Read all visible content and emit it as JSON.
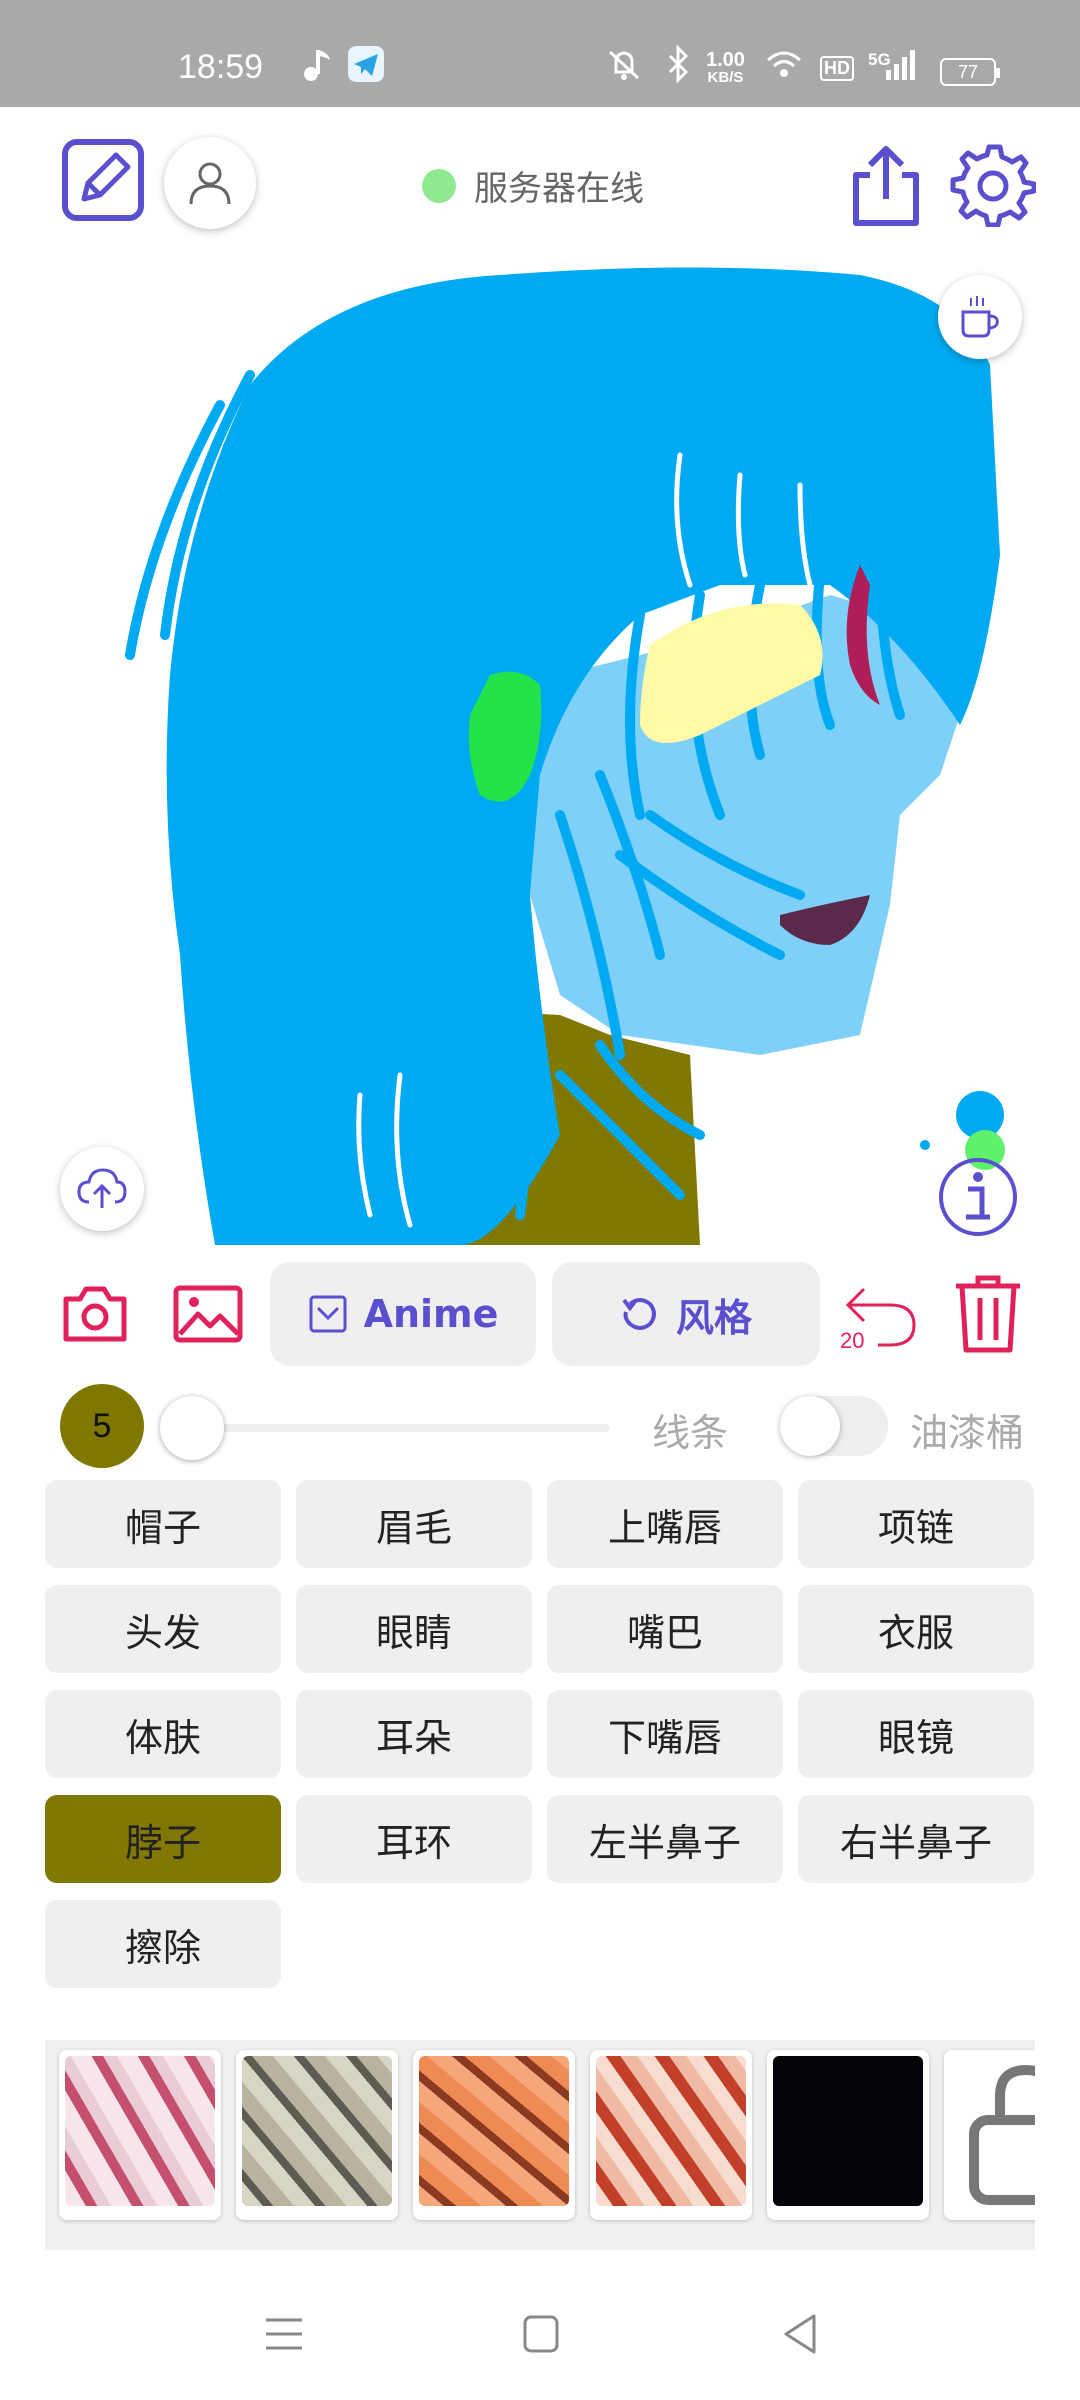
{
  "status_bar": {
    "time": "18:59",
    "net_speed_value": "1.00",
    "net_speed_unit": "KB/S",
    "network": "5G",
    "hd": "HD",
    "battery": "77"
  },
  "header": {
    "server_status": "服务器在线",
    "server_status_color": "#8fea8f"
  },
  "toolbar": {
    "anime_label": "Anime",
    "style_label": "风格",
    "undo_count": "20"
  },
  "brush": {
    "size": "5",
    "color": "#807800",
    "line_label": "线条",
    "bucket_label": "油漆桶",
    "bucket_enabled": false
  },
  "parts": [
    {
      "label": "帽子"
    },
    {
      "label": "眉毛"
    },
    {
      "label": "上嘴唇"
    },
    {
      "label": "项链"
    },
    {
      "label": "头发"
    },
    {
      "label": "眼睛"
    },
    {
      "label": "嘴巴"
    },
    {
      "label": "衣服"
    },
    {
      "label": "体肤"
    },
    {
      "label": "耳朵"
    },
    {
      "label": "下嘴唇"
    },
    {
      "label": "眼镜"
    },
    {
      "label": "脖子",
      "selected": true
    },
    {
      "label": "耳环"
    },
    {
      "label": "左半鼻子"
    },
    {
      "label": "右半鼻子"
    },
    {
      "label": "擦除"
    }
  ],
  "accent_color": "#5a4fcf",
  "danger_color": "#e0215a",
  "style_thumbnails": [
    "pink-marble",
    "grey-marble",
    "orange-marble",
    "red-marble",
    "black",
    "locked"
  ]
}
